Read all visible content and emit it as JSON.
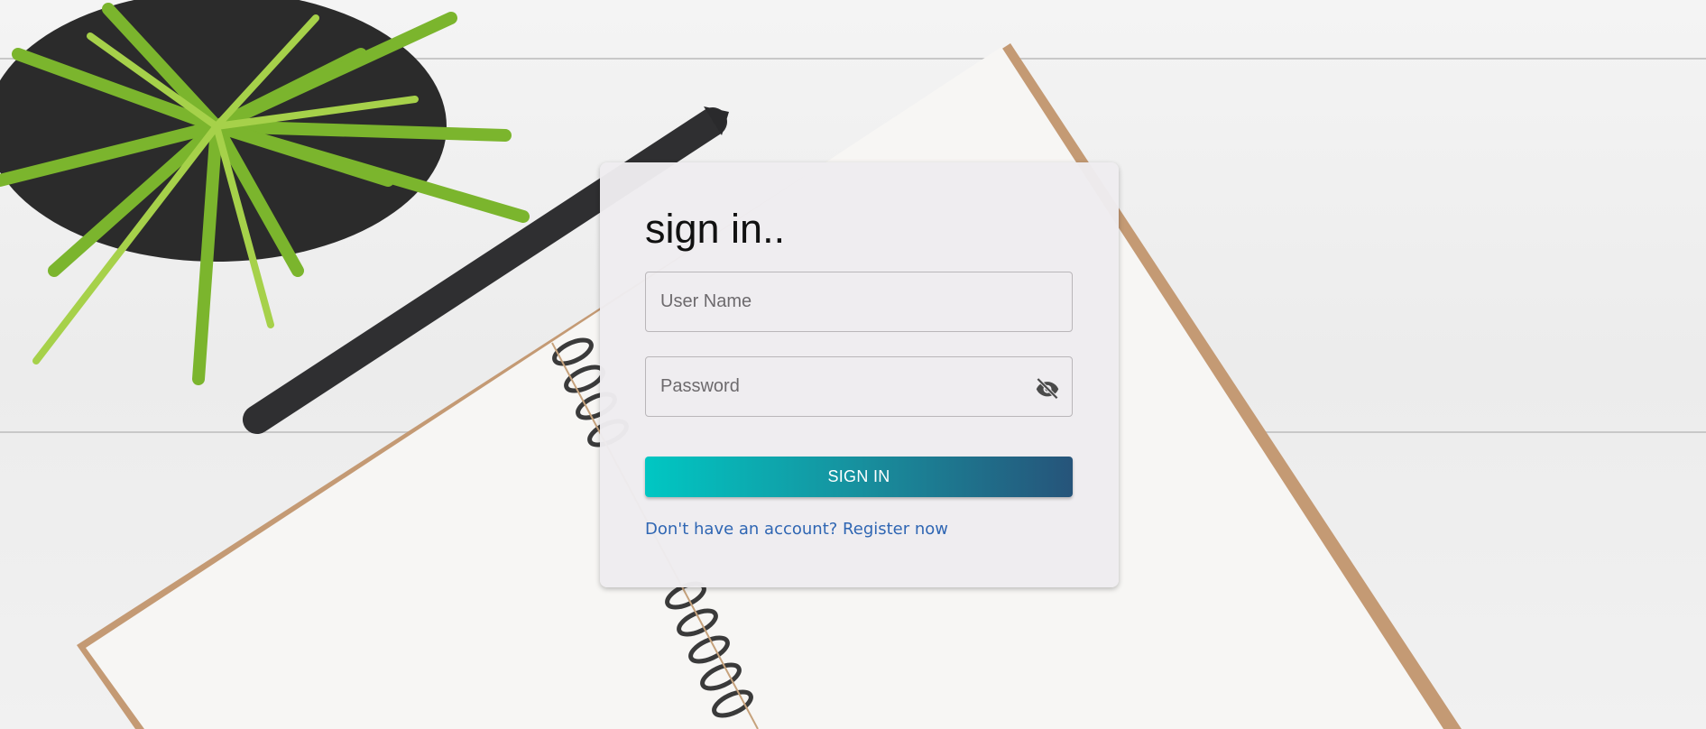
{
  "login": {
    "title": "sign in..",
    "username_placeholder": "User Name",
    "password_placeholder": "Password",
    "submit_label": "SIGN IN",
    "register_link": "Don't have an account? Register now"
  },
  "icons": {
    "password_toggle": "eye-off-icon"
  },
  "colors": {
    "button_gradient_start": "#00c7c3",
    "button_gradient_end": "#26547a",
    "link": "#2f66b3",
    "card_background": "#eeecef"
  }
}
